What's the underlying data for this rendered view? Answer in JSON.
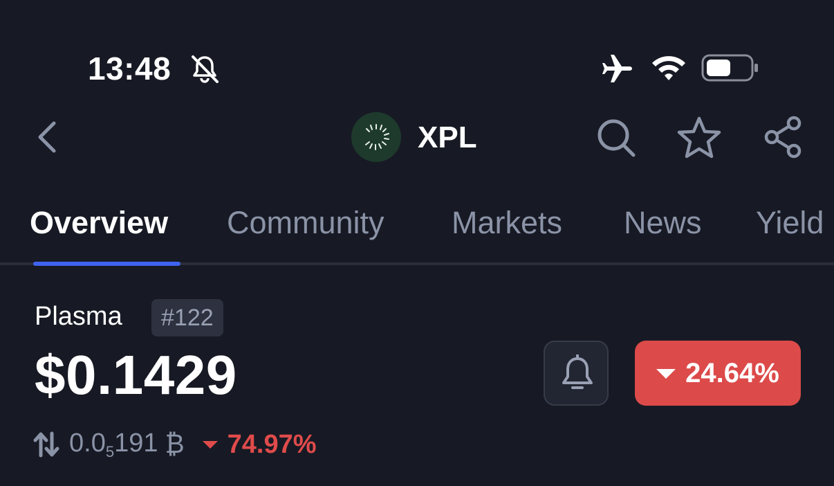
{
  "status_bar": {
    "time": "13:48",
    "icons": [
      "bell-slash-icon",
      "airplane-icon",
      "wifi-icon",
      "battery-icon"
    ]
  },
  "header": {
    "title": "XPL",
    "icons": [
      "chevron-left-icon",
      "search-icon",
      "star-icon",
      "share-icon"
    ]
  },
  "tabs": [
    {
      "label": "Overview",
      "active": true
    },
    {
      "label": "Community",
      "active": false
    },
    {
      "label": "Markets",
      "active": false
    },
    {
      "label": "News",
      "active": false
    },
    {
      "label": "Yield",
      "active": false
    }
  ],
  "coin": {
    "name": "Plasma",
    "rank": "#122",
    "price": "$0.1429",
    "change_24h": "24.64%",
    "change_direction": "down",
    "btc_price_prefix": "0.0",
    "btc_price_zeros": "5",
    "btc_price_suffix": "191",
    "btc_symbol": "₿",
    "btc_change": "74.97%"
  },
  "colors": {
    "background": "#171a24",
    "accent": "#3f63f0",
    "negative": "#dc4a4a",
    "muted_text": "#8b93a7"
  }
}
